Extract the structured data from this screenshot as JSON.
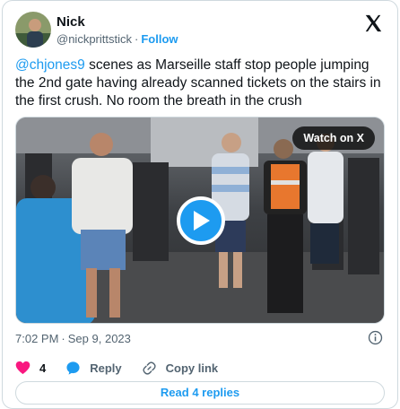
{
  "author": {
    "name": "Nick",
    "handle": "@nickprittstick",
    "separator": "·",
    "follow_label": "Follow"
  },
  "tweet": {
    "mention": "@chjones9",
    "text": " scenes as Marseille staff stop people jumping the 2nd gate having already scanned tickets on the stairs in the first crush. No room the breath in the crush"
  },
  "media": {
    "watch_label": "Watch on X",
    "play_icon": "play-icon"
  },
  "meta": {
    "time": "7:02 PM",
    "separator": "·",
    "date": "Sep 9, 2023"
  },
  "actions": {
    "like_count": "4",
    "reply_label": "Reply",
    "copy_label": "Copy link"
  },
  "replies_label": "Read 4 replies",
  "colors": {
    "accent": "#1d9bf0",
    "like": "#f91880",
    "muted": "#536471",
    "border": "#cfd9de"
  }
}
